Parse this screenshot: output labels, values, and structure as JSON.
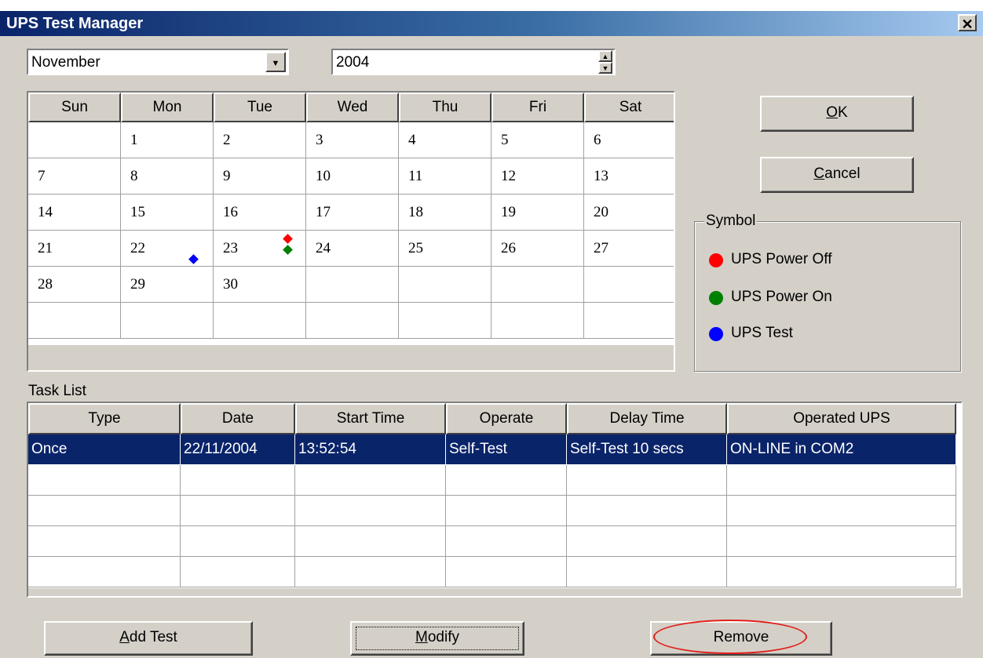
{
  "window": {
    "title": "UPS Test Manager",
    "close_glyph": "✕"
  },
  "month_select": {
    "value": "November",
    "arrow_icon": "chevron-down-icon"
  },
  "year_spin": {
    "value": "2004"
  },
  "calendar": {
    "weekdays": [
      "Sun",
      "Mon",
      "Tue",
      "Wed",
      "Thu",
      "Fri",
      "Sat"
    ],
    "weeks": [
      [
        "",
        "1",
        "2",
        "3",
        "4",
        "5",
        "6"
      ],
      [
        "7",
        "8",
        "9",
        "10",
        "11",
        "12",
        "13"
      ],
      [
        "14",
        "15",
        "16",
        "17",
        "18",
        "19",
        "20"
      ],
      [
        "21",
        "22",
        "23",
        "24",
        "25",
        "26",
        "27"
      ],
      [
        "28",
        "29",
        "30",
        "",
        "",
        "",
        ""
      ],
      [
        "",
        "",
        "",
        "",
        "",
        "",
        ""
      ]
    ],
    "markers": [
      {
        "day": "22",
        "symbols": [
          "UPS Test"
        ]
      },
      {
        "day": "23",
        "symbols": [
          "UPS Power Off",
          "UPS Power On"
        ]
      }
    ]
  },
  "buttons": {
    "ok": {
      "mnemonic": "O",
      "rest": "K"
    },
    "cancel": {
      "mnemonic": "C",
      "rest": "ancel"
    },
    "add_test": {
      "mnemonic": "A",
      "rest": "dd Test"
    },
    "modify": {
      "mnemonic": "M",
      "rest": "odify"
    },
    "remove": "Remove"
  },
  "symbol_legend": {
    "title": "Symbol",
    "items": [
      {
        "label": "UPS Power Off",
        "color": "#ff0000"
      },
      {
        "label": "UPS Power On",
        "color": "#008000"
      },
      {
        "label": "UPS Test",
        "color": "#0000ff"
      }
    ]
  },
  "task_list": {
    "label": "Task List",
    "columns": [
      "Type",
      "Date",
      "Start Time",
      "Operate",
      "Delay Time",
      "Operated UPS"
    ],
    "rows": [
      [
        "Once",
        "22/11/2004",
        "13:52:54",
        "Self-Test",
        "Self-Test 10 secs",
        "ON-LINE in COM2"
      ],
      [
        "",
        "",
        "",
        "",
        "",
        ""
      ],
      [
        "",
        "",
        "",
        "",
        "",
        ""
      ],
      [
        "",
        "",
        "",
        "",
        "",
        ""
      ],
      [
        "",
        "",
        "",
        "",
        "",
        ""
      ]
    ],
    "selected_row": 0
  },
  "colors": {
    "title_bar": "#0a246a",
    "selection": "#0a246a",
    "annotation_ellipse": "#e0201c"
  }
}
